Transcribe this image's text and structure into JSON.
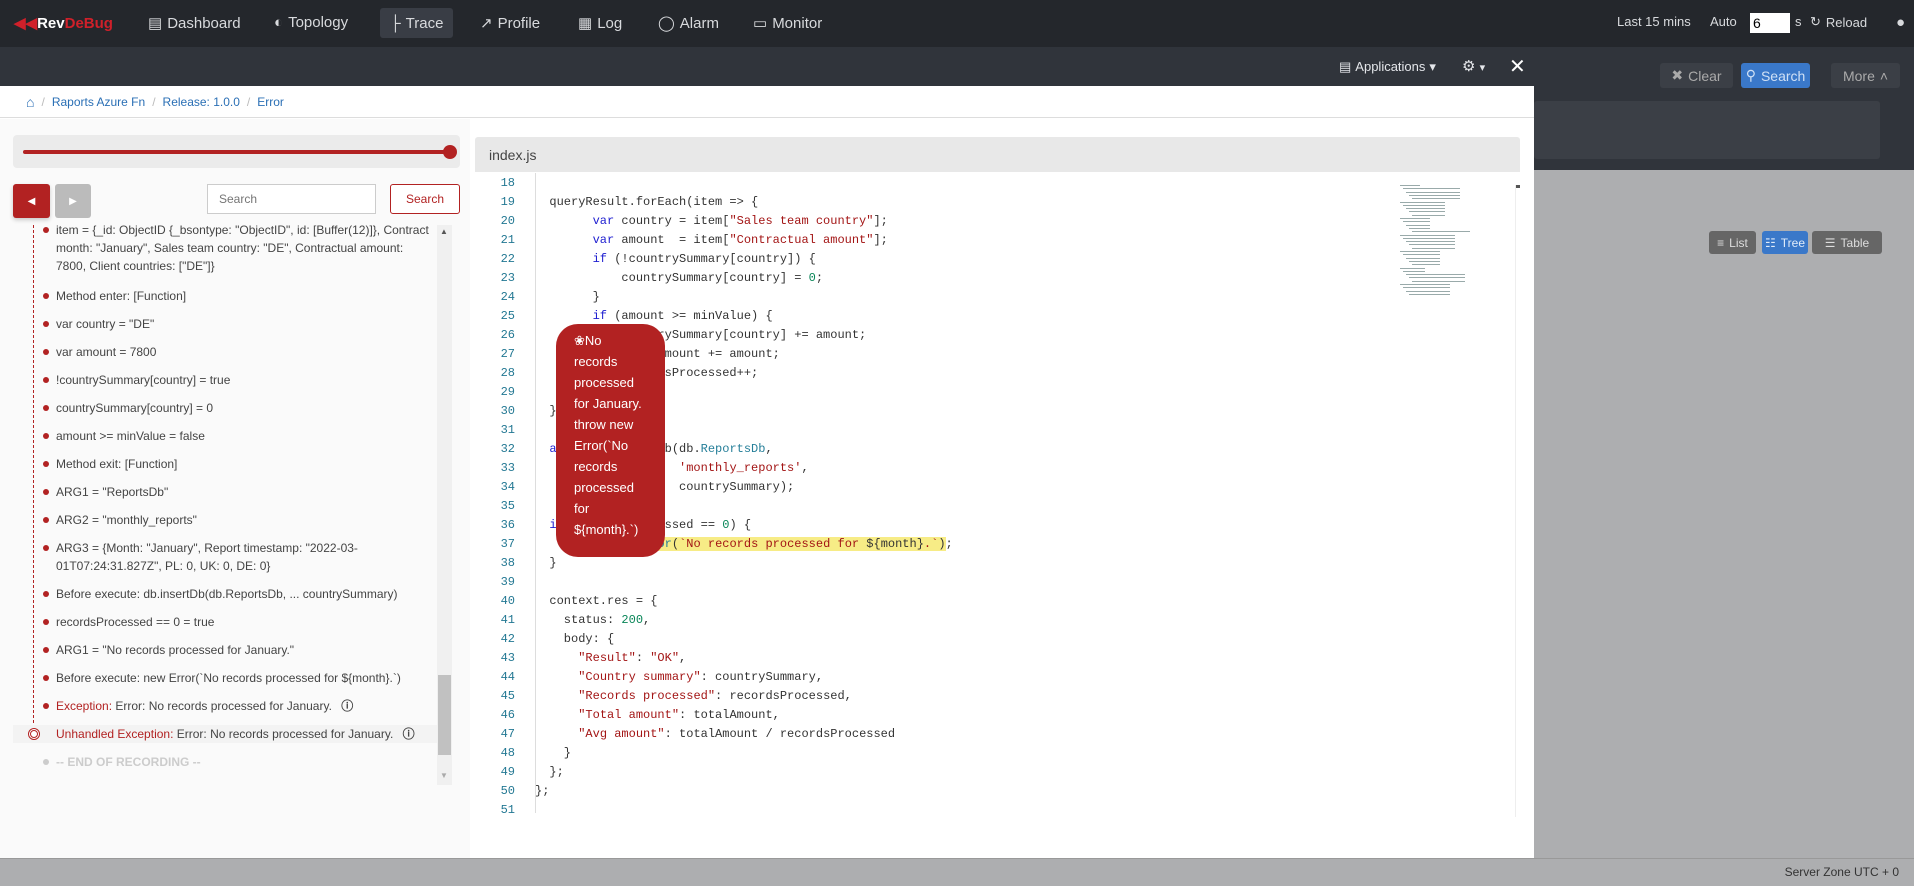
{
  "topnav": {
    "logo_a": "Rev",
    "logo_b": "DeBug",
    "items": [
      "Dashboard",
      "Topology",
      "Trace",
      "Profile",
      "Log",
      "Alarm",
      "Monitor"
    ],
    "time_range": "Last 15 mins",
    "auto": "Auto",
    "interval": "6",
    "unit": "s",
    "reload": "Reload"
  },
  "modal": {
    "applications": "Applications",
    "breadcrumb": [
      "Raports Azure Fn",
      "Release: 1.0.0",
      "Error"
    ]
  },
  "right": {
    "clear": "Clear",
    "search": "Search",
    "more": "More",
    "views": [
      "List",
      "Tree",
      "Table"
    ]
  },
  "left": {
    "slider_progress": 1.0,
    "search_placeholder": "Search",
    "search_button": "Search",
    "trace": [
      {
        "text": "item = {_id: ObjectID {_bsontype: \"ObjectID\", id: [Buffer(12)]}, Contract month: \"January\", Sales team country: \"DE\", Contractual amount: 7800, Client countries: [\"DE\"]}"
      },
      {
        "text": "Method enter: [Function]"
      },
      {
        "text": "var country = \"DE\""
      },
      {
        "text": "var amount = 7800"
      },
      {
        "text": "!countrySummary[country] = true"
      },
      {
        "text": "countrySummary[country] = 0"
      },
      {
        "text": "amount >= minValue = false"
      },
      {
        "text": "Method exit: [Function]"
      },
      {
        "text": "ARG1 = \"ReportsDb\""
      },
      {
        "text": "ARG2 = \"monthly_reports\""
      },
      {
        "text": "ARG3 = {Month: \"January\", Report timestamp: \"2022-03-01T07:24:31.827Z\", PL: 0, UK: 0, DE: 0}"
      },
      {
        "text": "Before execute: db.insertDb(db.ReportsDb, ... countrySummary)"
      },
      {
        "text": "recordsProcessed == 0 = true"
      },
      {
        "text": "ARG1 = \"No records processed for January.\""
      },
      {
        "text": "Before execute: new Error(`No records processed for ${month}.`)"
      },
      {
        "label": "Exception:",
        "text": " Error: No records processed for January."
      },
      {
        "label": "Unhandled Exception:",
        "text": " Error: No records processed for January."
      },
      {
        "text": "-- END OF RECORDING --"
      }
    ]
  },
  "editor": {
    "filename": "index.js",
    "tooltip": "No records processed for January. throw new Error(`No records processed for ${month}.`)",
    "lines": [
      {
        "n": "18",
        "tokens": []
      },
      {
        "n": "19",
        "tokens": [
          [
            "",
            "  queryResult.forEach(item => {"
          ]
        ]
      },
      {
        "n": "20",
        "tokens": [
          [
            "",
            "        "
          ],
          [
            "k",
            "var"
          ],
          [
            "",
            " country = item["
          ],
          [
            "s",
            "\"Sales team country\""
          ],
          [
            "",
            "];"
          ]
        ]
      },
      {
        "n": "21",
        "tokens": [
          [
            "",
            "        "
          ],
          [
            "k",
            "var"
          ],
          [
            "",
            " amount  = item["
          ],
          [
            "s",
            "\"Contractual amount\""
          ],
          [
            "",
            "];"
          ]
        ]
      },
      {
        "n": "22",
        "tokens": [
          [
            "",
            "        "
          ],
          [
            "k",
            "if"
          ],
          [
            "",
            " (!countrySummary[country]) {"
          ]
        ]
      },
      {
        "n": "23",
        "tokens": [
          [
            "",
            "            countrySummary[country] = "
          ],
          [
            "n",
            "0"
          ],
          [
            "",
            ";"
          ]
        ]
      },
      {
        "n": "24",
        "tokens": [
          [
            "",
            "        }"
          ]
        ]
      },
      {
        "n": "25",
        "tokens": [
          [
            "",
            "        "
          ],
          [
            "k",
            "if"
          ],
          [
            "",
            " (amount >= minValue) {"
          ]
        ]
      },
      {
        "n": "26",
        "tokens": [
          [
            "",
            "            countrySummary[country] += amount;"
          ]
        ]
      },
      {
        "n": "27",
        "tokens": [
          [
            "",
            "            totalAmount += amount;"
          ]
        ]
      },
      {
        "n": "28",
        "tokens": [
          [
            "",
            "            recordsProcessed++;"
          ]
        ]
      },
      {
        "n": "29",
        "tokens": [
          [
            "",
            "        }"
          ]
        ]
      },
      {
        "n": "30",
        "tokens": [
          [
            "",
            "  });"
          ]
        ]
      },
      {
        "n": "31",
        "tokens": []
      },
      {
        "n": "32",
        "tokens": [
          [
            "",
            "  "
          ],
          [
            "k",
            "await"
          ],
          [
            "",
            " db.insertDb(db."
          ],
          [
            "t",
            "ReportsDb"
          ],
          [
            "",
            ","
          ]
        ]
      },
      {
        "n": "33",
        "tokens": [
          [
            "",
            "                    "
          ],
          [
            "s",
            "'monthly_reports'"
          ],
          [
            "",
            ","
          ]
        ]
      },
      {
        "n": "34",
        "tokens": [
          [
            "",
            "                    countrySummary);"
          ]
        ]
      },
      {
        "n": "35",
        "tokens": []
      },
      {
        "n": "36",
        "tokens": [
          [
            "",
            "  "
          ],
          [
            "k",
            "if"
          ],
          [
            "",
            " (recordsProcessed == "
          ],
          [
            "n",
            "0"
          ],
          [
            "",
            ") {"
          ]
        ]
      },
      {
        "n": "37",
        "tokens": [
          [
            "",
            "    "
          ],
          [
            "k hl",
            "throw"
          ],
          [
            "hl",
            " "
          ],
          [
            "k hl",
            "new"
          ],
          [
            "hl",
            " "
          ],
          [
            "t hl",
            "Error"
          ],
          [
            "hl",
            "("
          ],
          [
            "s hl",
            "`No records processed for "
          ],
          [
            "hl",
            "${month}"
          ],
          [
            "s hl",
            ".`"
          ],
          [
            "hl",
            ")"
          ],
          [
            "",
            ";"
          ]
        ]
      },
      {
        "n": "38",
        "tokens": [
          [
            "",
            "  }"
          ]
        ]
      },
      {
        "n": "39",
        "tokens": []
      },
      {
        "n": "40",
        "tokens": [
          [
            "",
            "  context.res = {"
          ]
        ]
      },
      {
        "n": "41",
        "tokens": [
          [
            "",
            "    status: "
          ],
          [
            "n",
            "200"
          ],
          [
            "",
            ","
          ]
        ]
      },
      {
        "n": "42",
        "tokens": [
          [
            "",
            "    body: {"
          ]
        ]
      },
      {
        "n": "43",
        "tokens": [
          [
            "",
            "      "
          ],
          [
            "s",
            "\"Result\""
          ],
          [
            "",
            ": "
          ],
          [
            "s",
            "\"OK\""
          ],
          [
            "",
            ","
          ]
        ]
      },
      {
        "n": "44",
        "tokens": [
          [
            "",
            "      "
          ],
          [
            "s",
            "\"Country summary\""
          ],
          [
            "",
            ": countrySummary,"
          ]
        ]
      },
      {
        "n": "45",
        "tokens": [
          [
            "",
            "      "
          ],
          [
            "s",
            "\"Records processed\""
          ],
          [
            "",
            ": recordsProcessed,"
          ]
        ]
      },
      {
        "n": "46",
        "tokens": [
          [
            "",
            "      "
          ],
          [
            "s",
            "\"Total amount\""
          ],
          [
            "",
            ": totalAmount,"
          ]
        ]
      },
      {
        "n": "47",
        "tokens": [
          [
            "",
            "      "
          ],
          [
            "s",
            "\"Avg amount\""
          ],
          [
            "",
            ": totalAmount / recordsProcessed"
          ]
        ]
      },
      {
        "n": "48",
        "tokens": [
          [
            "",
            "    }"
          ]
        ]
      },
      {
        "n": "49",
        "tokens": [
          [
            "",
            "  };"
          ]
        ]
      },
      {
        "n": "50",
        "tokens": [
          [
            "",
            "};"
          ]
        ]
      },
      {
        "n": "51",
        "tokens": []
      }
    ]
  },
  "footer": {
    "zone": "Server Zone UTC + 0"
  },
  "colors": {
    "accent": "#b22222",
    "primary": "#3a78c9",
    "nav_bg": "#24272c"
  }
}
